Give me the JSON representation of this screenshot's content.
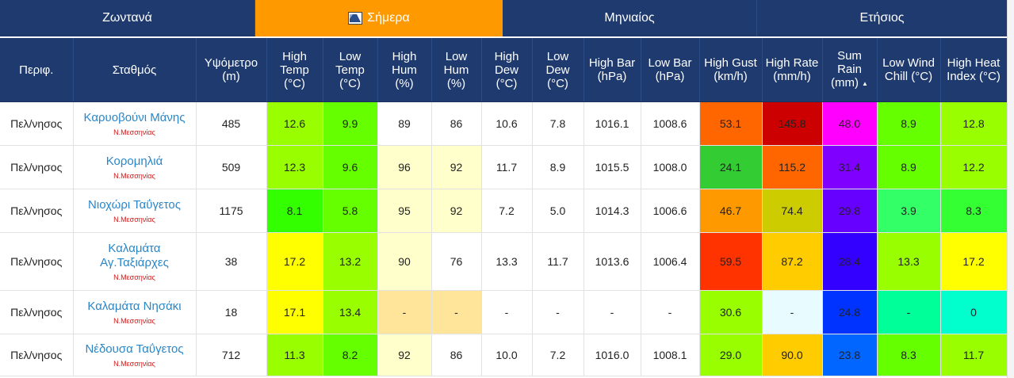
{
  "tabs": [
    {
      "label": "Ζωντανά",
      "active": false
    },
    {
      "label": "Σήμερα",
      "active": true,
      "icon": "chart-icon"
    },
    {
      "label": "Μηνιαίος",
      "active": false
    },
    {
      "label": "Ετήσιος",
      "active": false
    }
  ],
  "colors": {
    "header_bg": "#1e3a6e",
    "active_tab": "#ff9900",
    "link": "#2a86c8",
    "region": "#d01a1a"
  },
  "columns": [
    [
      "Περιφ."
    ],
    [
      "Σταθμός"
    ],
    [
      "Υψόμετρο",
      "(m)"
    ],
    [
      "High",
      "Temp",
      "(°C)"
    ],
    [
      "Low",
      "Temp",
      "(°C)"
    ],
    [
      "High",
      "Hum",
      "(%)"
    ],
    [
      "Low",
      "Hum",
      "(%)"
    ],
    [
      "High",
      "Dew",
      "(°C)"
    ],
    [
      "Low",
      "Dew",
      "(°C)"
    ],
    [
      "High Bar",
      "(hPa)"
    ],
    [
      "Low Bar",
      "(hPa)"
    ],
    [
      "High Gust",
      "(km/h)"
    ],
    [
      "High Rate",
      "(mm/h)"
    ],
    [
      "Sum",
      "Rain",
      "(mm)"
    ],
    [
      "Low Wind",
      "Chill (°C)"
    ],
    [
      "High Heat",
      "Index (°C)"
    ]
  ],
  "sorted_column_marker": "▲",
  "rows": [
    {
      "region": "Πελ/νησος",
      "station": [
        "Καρυοβούνι Μάνης"
      ],
      "subregion": "Ν.Μεσσηνίας",
      "cells": [
        "485",
        "12.6",
        "9.9",
        "89",
        "86",
        "10.6",
        "7.8",
        "1016.1",
        "1008.6",
        "53.1",
        "145.8",
        "48.0",
        "8.9",
        "12.8"
      ],
      "colors": [
        "#ffffff",
        "#99ff00",
        "#66ff00",
        "#ffffff",
        "#ffffff",
        "#ffffff",
        "#ffffff",
        "#ffffff",
        "#ffffff",
        "#ff6600",
        "#cc0000",
        "#ff00ff",
        "#66ff00",
        "#99ff00"
      ]
    },
    {
      "region": "Πελ/νησος",
      "station": [
        "Κορομηλιά"
      ],
      "subregion": "Ν.Μεσσηνίας",
      "cells": [
        "509",
        "12.3",
        "9.6",
        "96",
        "92",
        "11.7",
        "8.9",
        "1015.5",
        "1008.0",
        "24.1",
        "115.2",
        "31.4",
        "8.9",
        "12.2"
      ],
      "colors": [
        "#ffffff",
        "#99ff00",
        "#66ff00",
        "#ffffcc",
        "#ffffcc",
        "#ffffff",
        "#ffffff",
        "#ffffff",
        "#ffffff",
        "#33cc33",
        "#ff6600",
        "#7f00ff",
        "#66ff00",
        "#99ff00"
      ]
    },
    {
      "region": "Πελ/νησος",
      "station": [
        "Νιοχώρι Ταΰγετος"
      ],
      "subregion": "Ν.Μεσσηνίας",
      "cells": [
        "1175",
        "8.1",
        "5.8",
        "95",
        "92",
        "7.2",
        "5.0",
        "1014.3",
        "1006.6",
        "46.7",
        "74.4",
        "29.8",
        "3.9",
        "8.3"
      ],
      "colors": [
        "#ffffff",
        "#33ff00",
        "#66ff00",
        "#ffffcc",
        "#ffffcc",
        "#ffffff",
        "#ffffff",
        "#ffffff",
        "#ffffff",
        "#ff9900",
        "#cccc00",
        "#6600ff",
        "#33ff66",
        "#33ff33"
      ]
    },
    {
      "region": "Πελ/νησος",
      "station": [
        "Καλαμάτα",
        "Αγ.Ταξιάρχες"
      ],
      "subregion": "Ν.Μεσσηνίας",
      "cells": [
        "38",
        "17.2",
        "13.2",
        "90",
        "76",
        "13.3",
        "11.7",
        "1013.6",
        "1006.4",
        "59.5",
        "87.2",
        "28.4",
        "13.3",
        "17.2"
      ],
      "colors": [
        "#ffffff",
        "#ffff00",
        "#99ff00",
        "#ffffcc",
        "#ffffff",
        "#ffffff",
        "#ffffff",
        "#ffffff",
        "#ffffff",
        "#ff3300",
        "#ffcc00",
        "#3300ff",
        "#99ff00",
        "#ffff00"
      ]
    },
    {
      "region": "Πελ/νησος",
      "station": [
        "Καλαμάτα Νησάκι"
      ],
      "subregion": "Ν.Μεσσηνίας",
      "cells": [
        "18",
        "17.1",
        "13.4",
        "-",
        "-",
        "-",
        "-",
        "-",
        "-",
        "30.6",
        "-",
        "24.8",
        "-",
        "0"
      ],
      "colors": [
        "#ffffff",
        "#ffff00",
        "#99ff00",
        "#ffe599",
        "#ffe599",
        "#ffffff",
        "#ffffff",
        "#ffffff",
        "#ffffff",
        "#99ff00",
        "#e8fcff",
        "#0033ff",
        "#00ff99",
        "#00ffcc"
      ]
    },
    {
      "region": "Πελ/νησος",
      "station": [
        "Νέδουσα Ταΰγετος"
      ],
      "subregion": "Ν.Μεσσηνίας",
      "cells": [
        "712",
        "11.3",
        "8.2",
        "92",
        "86",
        "10.0",
        "7.2",
        "1016.0",
        "1008.1",
        "29.0",
        "90.0",
        "23.8",
        "8.3",
        "11.7"
      ],
      "colors": [
        "#ffffff",
        "#99ff00",
        "#66ff00",
        "#ffffcc",
        "#ffffff",
        "#ffffff",
        "#ffffff",
        "#ffffff",
        "#ffffff",
        "#99ff00",
        "#ffcc00",
        "#0066ff",
        "#66ff00",
        "#99ff00"
      ]
    }
  ]
}
